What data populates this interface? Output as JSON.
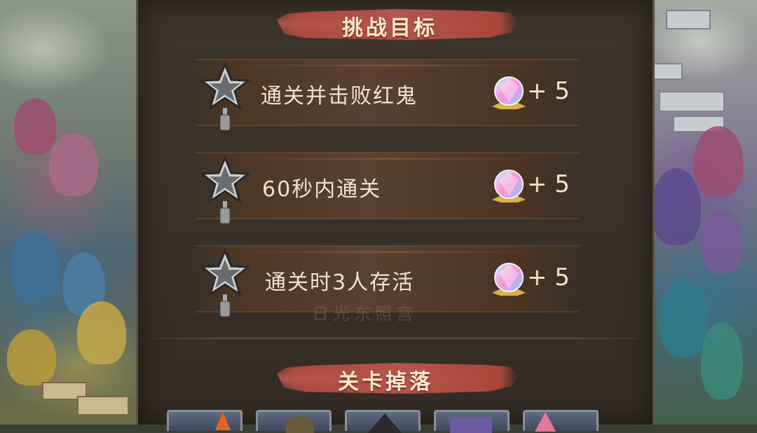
{
  "challenge": {
    "title": "挑战目标",
    "objectives": [
      {
        "text": "通关并击败红鬼",
        "reward": "+ 5",
        "star_icon": "silver-star-medal-icon",
        "reward_icon": "crystal-gem-icon"
      },
      {
        "text": "60秒内通关",
        "reward": "+ 5",
        "star_icon": "silver-star-medal-icon",
        "reward_icon": "crystal-gem-icon"
      },
      {
        "text": "通关时3人存活",
        "reward": "+ 5",
        "star_icon": "silver-star-medal-icon",
        "reward_icon": "crystal-gem-icon"
      }
    ]
  },
  "drops": {
    "title": "关卡掉落",
    "slots": [
      {
        "name": "drop-item-1",
        "accent": "#e8641e"
      },
      {
        "name": "drop-item-2",
        "accent": "#6a5a3c"
      },
      {
        "name": "drop-item-3",
        "accent": "#2a2a2a"
      },
      {
        "name": "drop-item-4",
        "accent": "#6c5aa0"
      },
      {
        "name": "drop-item-5",
        "accent": "#e07a9a"
      }
    ]
  },
  "colors": {
    "banner": "#b4564a",
    "panel": "#3a3129",
    "text": "#f1e4c9"
  }
}
